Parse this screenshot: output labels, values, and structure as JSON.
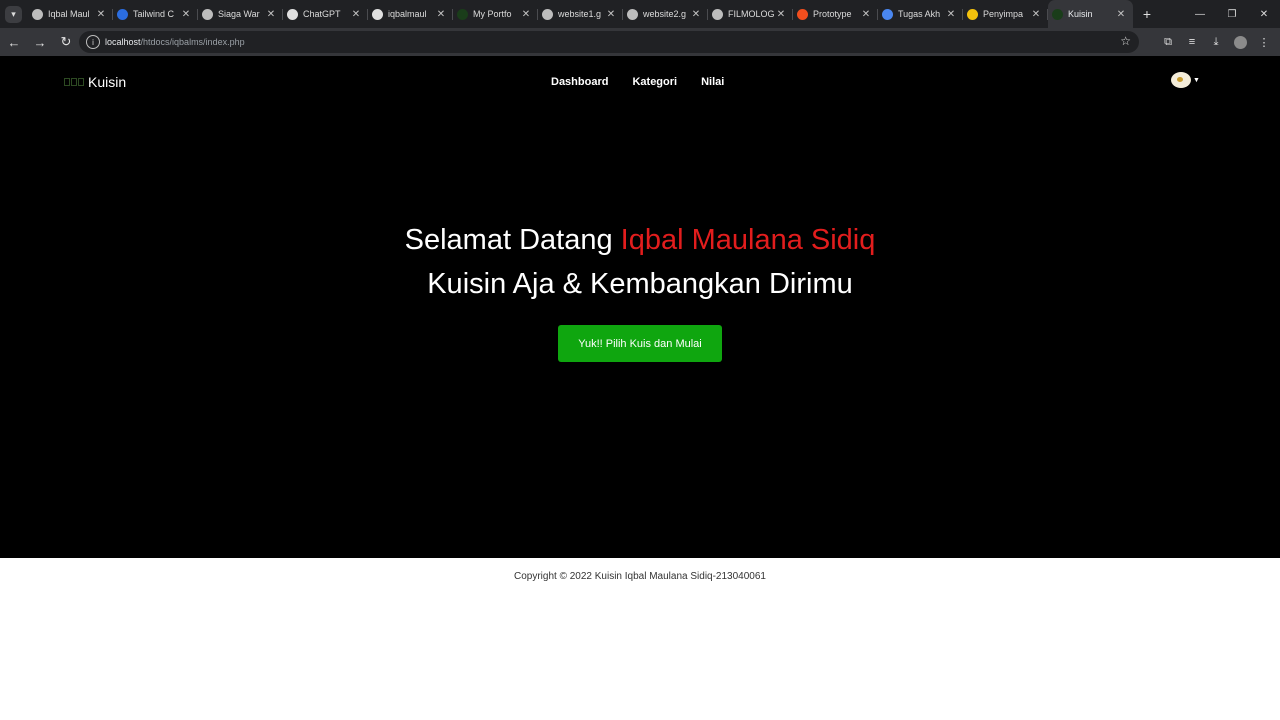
{
  "browser": {
    "tabs": [
      {
        "title": "Iqbal Maul",
        "favicon_color": "#bdbdbd"
      },
      {
        "title": "Tailwind C",
        "favicon_color": "#2b6de0"
      },
      {
        "title": "Siaga War",
        "favicon_color": "#bdbdbd"
      },
      {
        "title": "ChatGPT",
        "favicon_color": "#e0e0e0"
      },
      {
        "title": "iqbalmaul",
        "favicon_color": "#e0e0e0"
      },
      {
        "title": "My Portfo",
        "favicon_color": "#1a3d1a"
      },
      {
        "title": "website1.g",
        "favicon_color": "#bdbdbd"
      },
      {
        "title": "website2.g",
        "favicon_color": "#bdbdbd"
      },
      {
        "title": "FILMOLOG",
        "favicon_color": "#bdbdbd"
      },
      {
        "title": "Prototype",
        "favicon_color": "#f24e1e"
      },
      {
        "title": "Tugas Akh",
        "favicon_color": "#4a87f0"
      },
      {
        "title": "Penyimpa",
        "favicon_color": "#f4c20d"
      },
      {
        "title": "Kuisin",
        "favicon_color": "#1a3d1a",
        "active": true
      }
    ],
    "url_host": "localhost",
    "url_path": "/htdocs/iqbalms/index.php"
  },
  "site": {
    "brand": "Kuisin",
    "nav": [
      "Dashboard",
      "Kategori",
      "Nilai"
    ],
    "hero": {
      "greeting": "Selamat Datang ",
      "name": "Iqbal Maulana Sidiq",
      "tagline": "Kuisin Aja & Kembangkan Dirimu",
      "cta": "Yuk!! Pilih Kuis dan Mulai"
    },
    "footer": "Copyright © 2022 Kuisin Iqbal Maulana Sidiq-213040061"
  }
}
